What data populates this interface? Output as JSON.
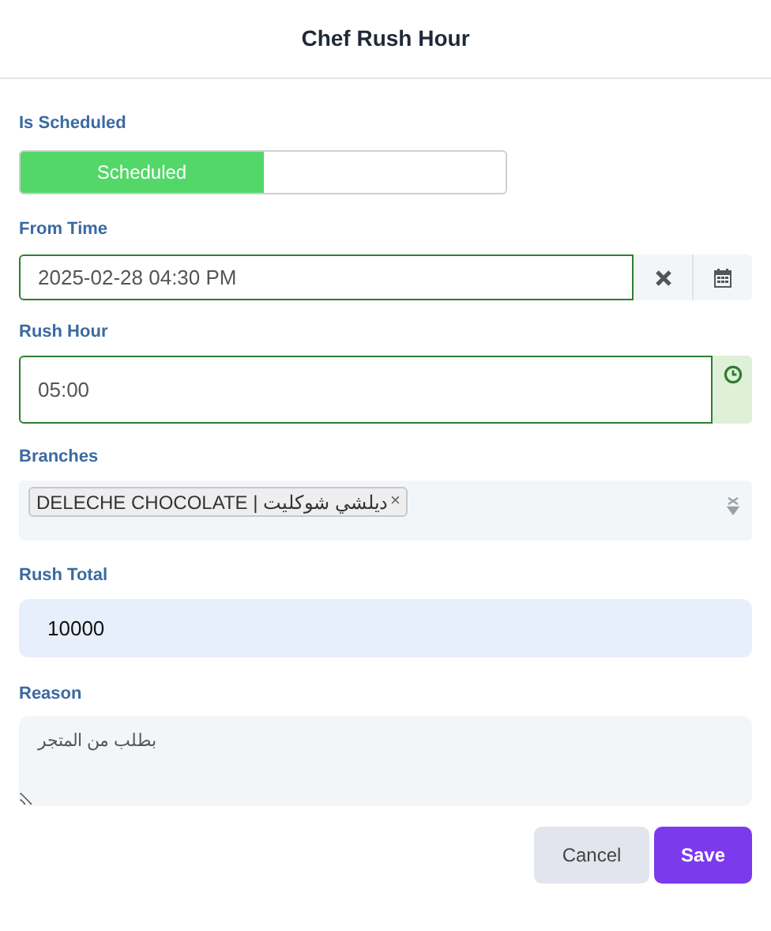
{
  "window": {
    "title": "Chef Rush Hour"
  },
  "is_scheduled": {
    "label": "Is Scheduled",
    "option": "Scheduled",
    "on": true
  },
  "from_time": {
    "label": "From Time",
    "value": "2025-02-28 04:30 PM"
  },
  "rush_hour": {
    "label": "Rush Hour",
    "value": "05:00"
  },
  "branches": {
    "label": "Branches",
    "tags": [
      {
        "text": "DELECHE CHOCOLATE | ديلشي شوكليت",
        "remove": "×"
      }
    ]
  },
  "rush_total": {
    "label": "Rush Total",
    "value": "10000"
  },
  "reason": {
    "label": "Reason",
    "value": "بطلب من المتجر"
  },
  "buttons": [
    {
      "kind": "secondary",
      "label": "Cancel"
    },
    {
      "kind": "primary",
      "label": "Save"
    }
  ]
}
